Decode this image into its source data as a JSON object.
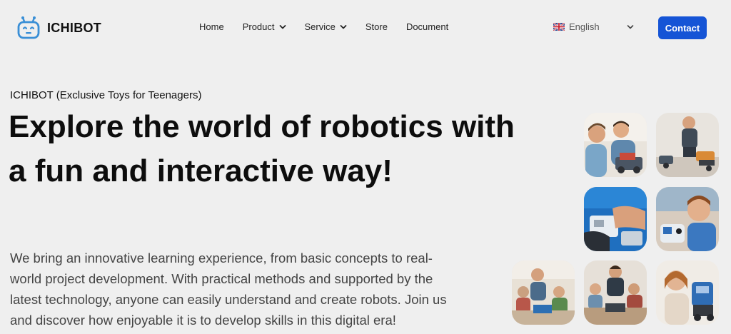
{
  "brand": {
    "name": "ICHIBOT",
    "logo_icon": "robot-head-icon",
    "accent": "#3a8fd6"
  },
  "nav": {
    "items": [
      {
        "label": "Home",
        "has_dropdown": false
      },
      {
        "label": "Product",
        "has_dropdown": true
      },
      {
        "label": "Service",
        "has_dropdown": true
      },
      {
        "label": "Store",
        "has_dropdown": false
      },
      {
        "label": "Document",
        "has_dropdown": false
      }
    ]
  },
  "language": {
    "label": "English",
    "flag_icon": "uk-flag-icon"
  },
  "contact": {
    "label": "Contact",
    "color": "#1554d6"
  },
  "hero": {
    "eyebrow": "ICHIBOT (Exclusive Toys for Teenagers)",
    "headline_line1": "Explore the world of robotics with",
    "headline_line2": "a fun and interactive way!",
    "description_line1": "We bring an innovative learning experience, from basic concepts to real-",
    "description_line2": "world project development. With practical methods and supported by the",
    "description_line3": "latest technology, anyone can easily understand and create robots. Join us",
    "description_line4": "and discover how enjoyable it is to develop skills in this digital era!"
  },
  "gallery": {
    "tiles": [
      {
        "name": "photo-boys-building-robot"
      },
      {
        "name": "photo-boy-with-robot-kit"
      },
      {
        "name": "photo-hands-assembling-robot"
      },
      {
        "name": "photo-boy-holding-robot"
      },
      {
        "name": "photo-classroom-robotics"
      },
      {
        "name": "photo-teacher-with-kids"
      },
      {
        "name": "photo-girl-with-robot"
      }
    ]
  }
}
